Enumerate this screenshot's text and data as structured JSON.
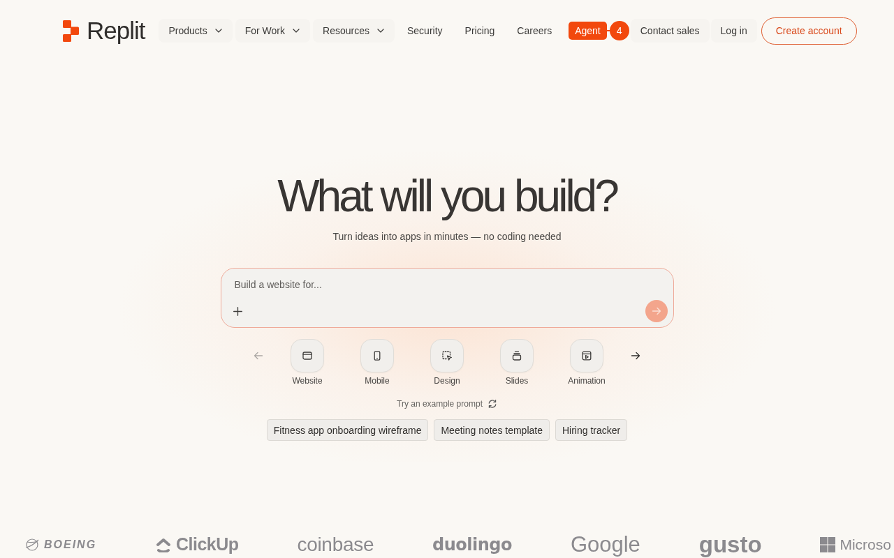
{
  "header": {
    "logo": "Replit",
    "nav": [
      {
        "label": "Products",
        "kind": "dropdown"
      },
      {
        "label": "For Work",
        "kind": "dropdown"
      },
      {
        "label": "Resources",
        "kind": "dropdown"
      },
      {
        "label": "Security",
        "kind": "link"
      },
      {
        "label": "Pricing",
        "kind": "link"
      },
      {
        "label": "Careers",
        "kind": "link"
      }
    ],
    "agent": {
      "label": "Agent",
      "count": "4"
    },
    "actions": [
      {
        "label": "Contact sales",
        "kind": "link"
      },
      {
        "label": "Log in",
        "kind": "link"
      },
      {
        "label": "Create account",
        "kind": "outline"
      }
    ]
  },
  "hero": {
    "title": "What will you build?",
    "subtitle": "Turn ideas into apps in minutes — no coding needed"
  },
  "prompt": {
    "placeholder": "Build a website for...",
    "send_disabled": true
  },
  "categories": {
    "prev_disabled": true,
    "next_disabled": false,
    "items": [
      {
        "label": "Website",
        "kind": "website"
      },
      {
        "label": "Mobile",
        "kind": "mobile"
      },
      {
        "label": "Design",
        "kind": "design"
      },
      {
        "label": "Slides",
        "kind": "slides"
      },
      {
        "label": "Animation",
        "kind": "animation"
      }
    ]
  },
  "examples": {
    "label": "Try an example prompt",
    "prompts": [
      "Fitness app onboarding wireframe",
      "Meeting notes template",
      "Hiring tracker"
    ]
  },
  "logos": [
    {
      "name": "BOEING",
      "kind": "boeing"
    },
    {
      "name": "ClickUp",
      "kind": "clickup"
    },
    {
      "name": "coinbase",
      "kind": "coinbase"
    },
    {
      "name": "duolingo",
      "kind": "duolingo"
    },
    {
      "name": "Google",
      "kind": "google"
    },
    {
      "name": "gusto",
      "kind": "gusto"
    },
    {
      "name": "Microso",
      "kind": "microsoft"
    }
  ]
}
